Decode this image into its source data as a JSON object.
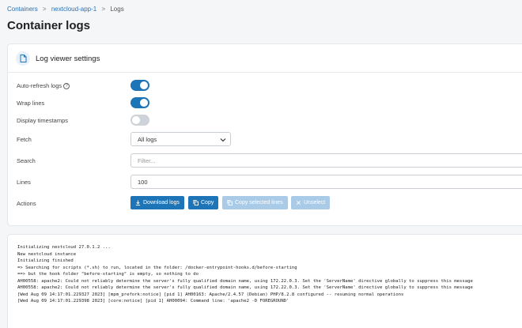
{
  "breadcrumb": {
    "items": [
      "Containers",
      "nextcloud-app-1",
      "Logs"
    ],
    "separator": ">"
  },
  "page_title": "Container logs",
  "settings": {
    "title": "Log viewer settings",
    "icon": "document-icon",
    "auto_refresh": {
      "label": "Auto-refresh logs",
      "on": true,
      "help_icon": "?"
    },
    "wrap_lines": {
      "label": "Wrap lines",
      "on": true
    },
    "timestamps": {
      "label": "Display timestamps",
      "on": false
    },
    "fetch": {
      "label": "Fetch",
      "value": "All logs"
    },
    "search": {
      "label": "Search",
      "placeholder": "Filter..."
    },
    "lines": {
      "label": "Lines",
      "value": "100"
    },
    "actions": {
      "label": "Actions",
      "download": "Download logs",
      "copy": "Copy",
      "copy_selected": "Copy selected lines",
      "unselect": "Unselect"
    }
  },
  "colors": {
    "accent": "#1d75b8",
    "accent_disabled": "#a9cbe8"
  },
  "logs": [
    "Initializing nextcloud 27.0.1.2 ...",
    "New nextcloud instance",
    "Initializing finished",
    "=> Searching for scripts (*.sh) to run, located in the folder: /docker-entrypoint-hooks.d/before-starting",
    "==> but the hook folder \"before-starting\" is empty, so nothing to do",
    "AH00558: apache2: Could not reliably determine the server's fully qualified domain name, using 172.22.0.3. Set the 'ServerName' directive globally to suppress this message",
    "AH00558: apache2: Could not reliably determine the server's fully qualified domain name, using 172.22.0.3. Set the 'ServerName' directive globally to suppress this message",
    "[Wed Aug 09 14:17:01.229327 2023] [mpm_prefork:notice] [pid 1] AH00163: Apache/2.4.57 (Debian) PHP/8.2.8 configured -- resuming normal operations",
    "[Wed Aug 09 14:17:01.229398 2023] [core:notice] [pid 1] AH00094: Command line: 'apache2 -D FOREGROUND'"
  ]
}
